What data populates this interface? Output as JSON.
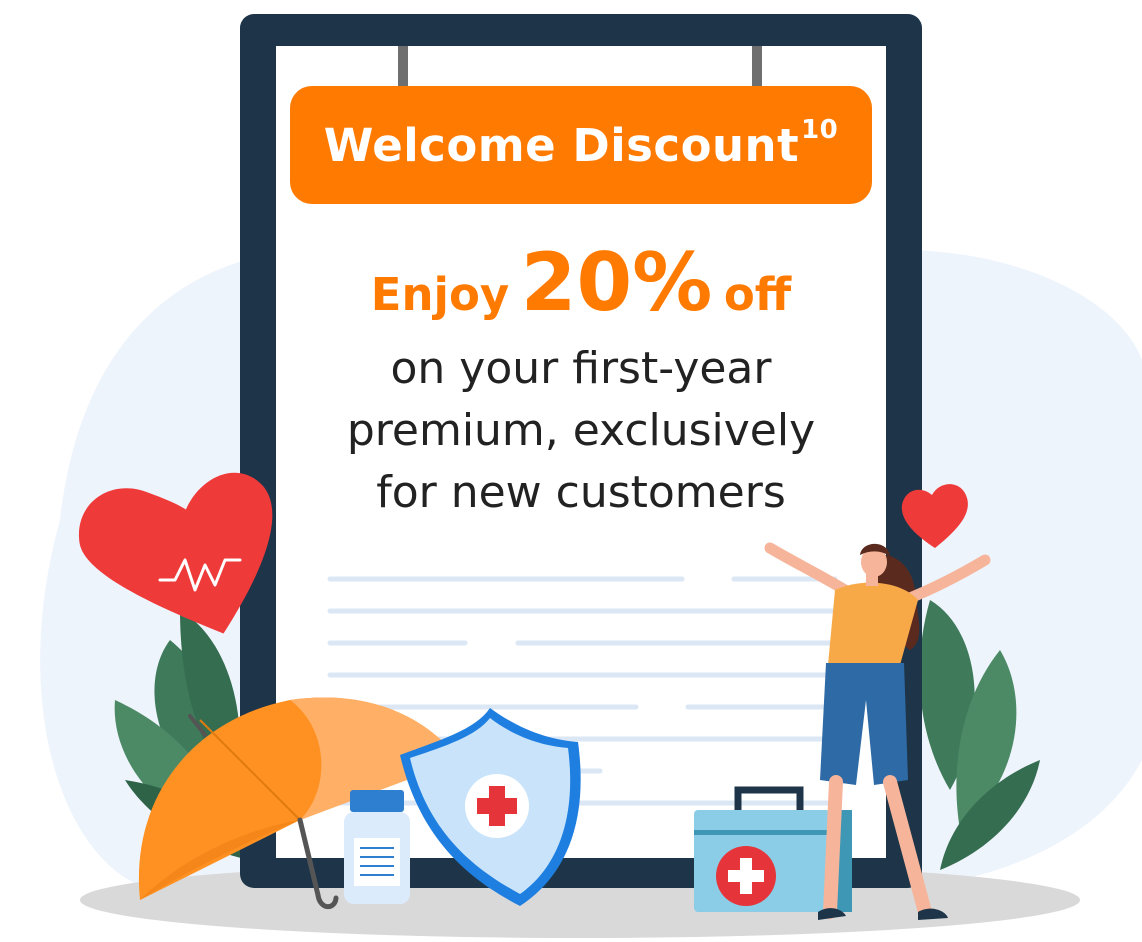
{
  "colors": {
    "accent": "#FF7A00",
    "frame": "#1E3549",
    "paper": "#FFFFFF",
    "blob": "#EEF4FC",
    "text": "#222222",
    "lines": "#DCE7F6"
  },
  "promo": {
    "title": "Welcome Discount",
    "title_superscript": "10",
    "offer_prefix": "Enjoy",
    "offer_value": "20%",
    "offer_suffix": "off",
    "body_line_1": "on your first-year",
    "body_line_2": "premium, exclusively",
    "body_line_3": "for new customers"
  },
  "icons": [
    "heart-rate-icon",
    "heart-icon",
    "umbrella-icon",
    "shield-cross-icon",
    "medicine-bottle-icon",
    "first-aid-kit-icon",
    "leaf-plant-icon",
    "person-celebrating-icon"
  ]
}
